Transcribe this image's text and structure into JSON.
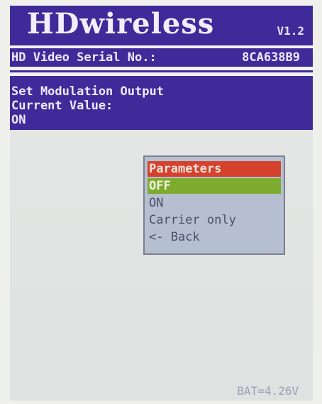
{
  "header": {
    "app_title": "HDwireless",
    "version": "V1.2"
  },
  "serial": {
    "label": "HD Video Serial No.:",
    "value": "8CA638B9"
  },
  "info": {
    "line1": "Set Modulation Output",
    "line2": "Current Value:",
    "line3": "ON"
  },
  "menu": {
    "header": "Parameters",
    "items": [
      {
        "label": "OFF",
        "selected": true
      },
      {
        "label": "ON",
        "selected": false
      },
      {
        "label": "Carrier only",
        "selected": false
      },
      {
        "label": "<- Back",
        "selected": false
      }
    ]
  },
  "status": {
    "battery": "BAT=4.26V"
  },
  "colors": {
    "panel_blue": "#3f2a9a",
    "menu_header_red": "#d4422d",
    "menu_selected_green": "#7dab2e",
    "menu_bg": "#b5bfd0"
  }
}
